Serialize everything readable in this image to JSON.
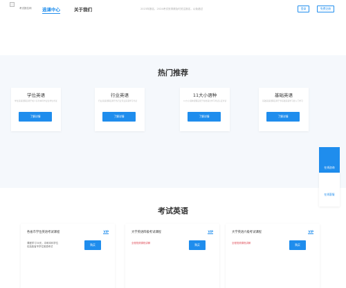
{
  "header": {
    "logo_text": "考试报名网",
    "nav": {
      "courses": "选课中心",
      "about": "关于我们"
    },
    "notice": "2023年报名，2024考试安排请及时关注报名，以免错过",
    "login": "登录",
    "register": "免费注册"
  },
  "hot": {
    "title": "热门推荐",
    "cards": [
      {
        "title": "学位英语",
        "desc": "学位英语课程适用于成人高考本科毕业生学位考试",
        "button": "了解详情"
      },
      {
        "title": "行业英语",
        "desc": "行业英语课程适用于各行业专业英语学习考试",
        "button": "了解详情"
      },
      {
        "title": "11大小语种",
        "desc": "11大小语种课程适用于各类语言学习考试认证考试",
        "button": "了解详情"
      },
      {
        "title": "基础英语",
        "desc": "基础英语课程适用于零基础英语学习者入门学习",
        "button": "了解详情"
      }
    ]
  },
  "side": {
    "top": "在线咨询",
    "bottom": "在线客服"
  },
  "exam": {
    "title": "考试英语",
    "cards": [
      {
        "title": "各省市学位英语考试课程",
        "badge": "VIP",
        "line1": "课程学习30天，冲刺本科学位",
        "line2": "包括各省市学位英语考试",
        "line1_red": false,
        "button": "购买"
      },
      {
        "title": "大学英语四级考试课程",
        "badge": "VIP",
        "line1": "全程视频课程讲解",
        "line2": "",
        "line1_red": true,
        "button": "购买"
      },
      {
        "title": "大学英语六级考试课程",
        "badge": "VIP",
        "line1": "全程视频课程讲解",
        "line2": "",
        "line1_red": true,
        "button": "购买"
      }
    ]
  },
  "colors": {
    "accent": "#1f8ded",
    "section_bg": "#f5f8fc",
    "red_text": "#e0545e"
  }
}
